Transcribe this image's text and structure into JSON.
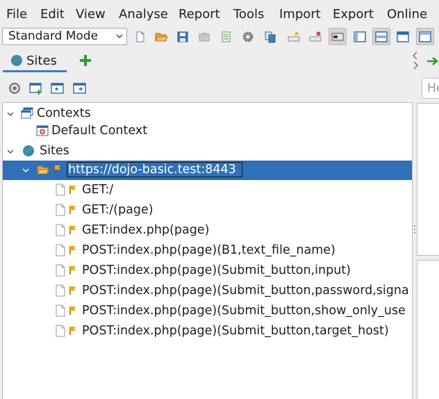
{
  "menu": [
    "File",
    "Edit",
    "View",
    "Analyse",
    "Report",
    "Tools",
    "Import",
    "Export",
    "Online"
  ],
  "toolbar": {
    "mode": "Standard Mode",
    "buttons": [
      "new-session",
      "open-session",
      "save-session",
      "snapshot-session",
      "session-properties",
      "options",
      "check-updates",
      "break-add",
      "break-remove",
      "toggle-tab-names",
      "layout-full",
      "layout-side",
      "layout-tabs",
      "layout-panes"
    ]
  },
  "tabs": {
    "sites": "Sites"
  },
  "right_search": {
    "placeholder": "He"
  },
  "tree": {
    "contexts": "Contexts",
    "default_context": "Default Context",
    "sites": "Sites",
    "host": "https://dojo-basic.test:8443",
    "children": [
      "GET:/",
      "GET:/(page)",
      "GET:index.php(page)",
      "POST:index.php(page)(B1,text_file_name)",
      "POST:index.php(page)(Submit_button,input)",
      "POST:index.php(page)(Submit_button,password,signa",
      "POST:index.php(page)(Submit_button,show_only_use",
      "POST:index.php(page)(Submit_button,target_host)"
    ]
  },
  "colors": {
    "selection": "#2f70b9",
    "accent_green": "#2e9e2e",
    "tab_underline": "#3b7dc4"
  }
}
